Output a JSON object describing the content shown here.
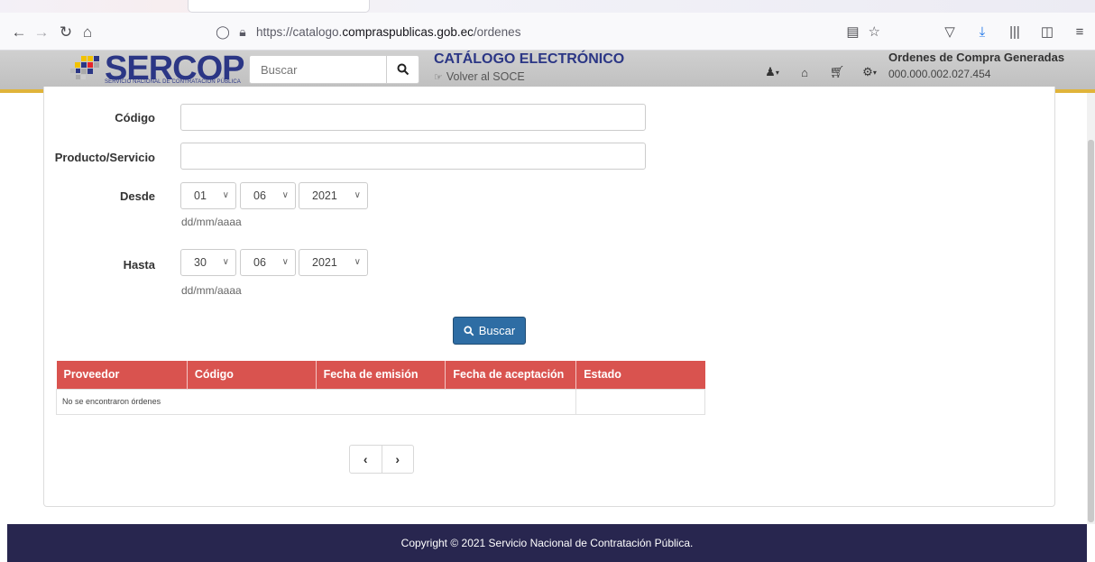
{
  "browser": {
    "url_prefix": "https://catalogo.",
    "url_domain": "compraspublicas.gob.ec",
    "url_path": "/ordenes"
  },
  "header": {
    "logo_text": "SERCOP",
    "logo_tagline": "SERVICIO NACIONAL DE CONTRATACIÓN PÚBLICA",
    "search_placeholder": "Buscar",
    "catalog_title": "CATÁLOGO ELECTRÓNICO",
    "back_link": "Volver al SOCE",
    "orders_title": "Ordenes de Compra Generadas",
    "orders_count": "000.000.002.027.454"
  },
  "form": {
    "codigo_label": "Código",
    "producto_label": "Producto/Servicio",
    "desde_label": "Desde",
    "hasta_label": "Hasta",
    "desde": {
      "day": "01",
      "month": "06",
      "year": "2021"
    },
    "hasta": {
      "day": "30",
      "month": "06",
      "year": "2021"
    },
    "date_hint": "dd/mm/aaaa",
    "search_button": "Buscar"
  },
  "table": {
    "columns": [
      "Proveedor",
      "Código",
      "Fecha de emisión",
      "Fecha de aceptación",
      "Estado"
    ],
    "empty_message": "No se encontraron órdenes"
  },
  "footer": {
    "copyright": "Copyright © 2021 Servicio Nacional de Contratación Pública."
  },
  "colors": {
    "brand_blue": "#2b3685",
    "accent_gold": "#e0b43a",
    "table_header": "#d9534f",
    "button_primary": "#2e6da4",
    "footer_bg": "#28264f"
  }
}
